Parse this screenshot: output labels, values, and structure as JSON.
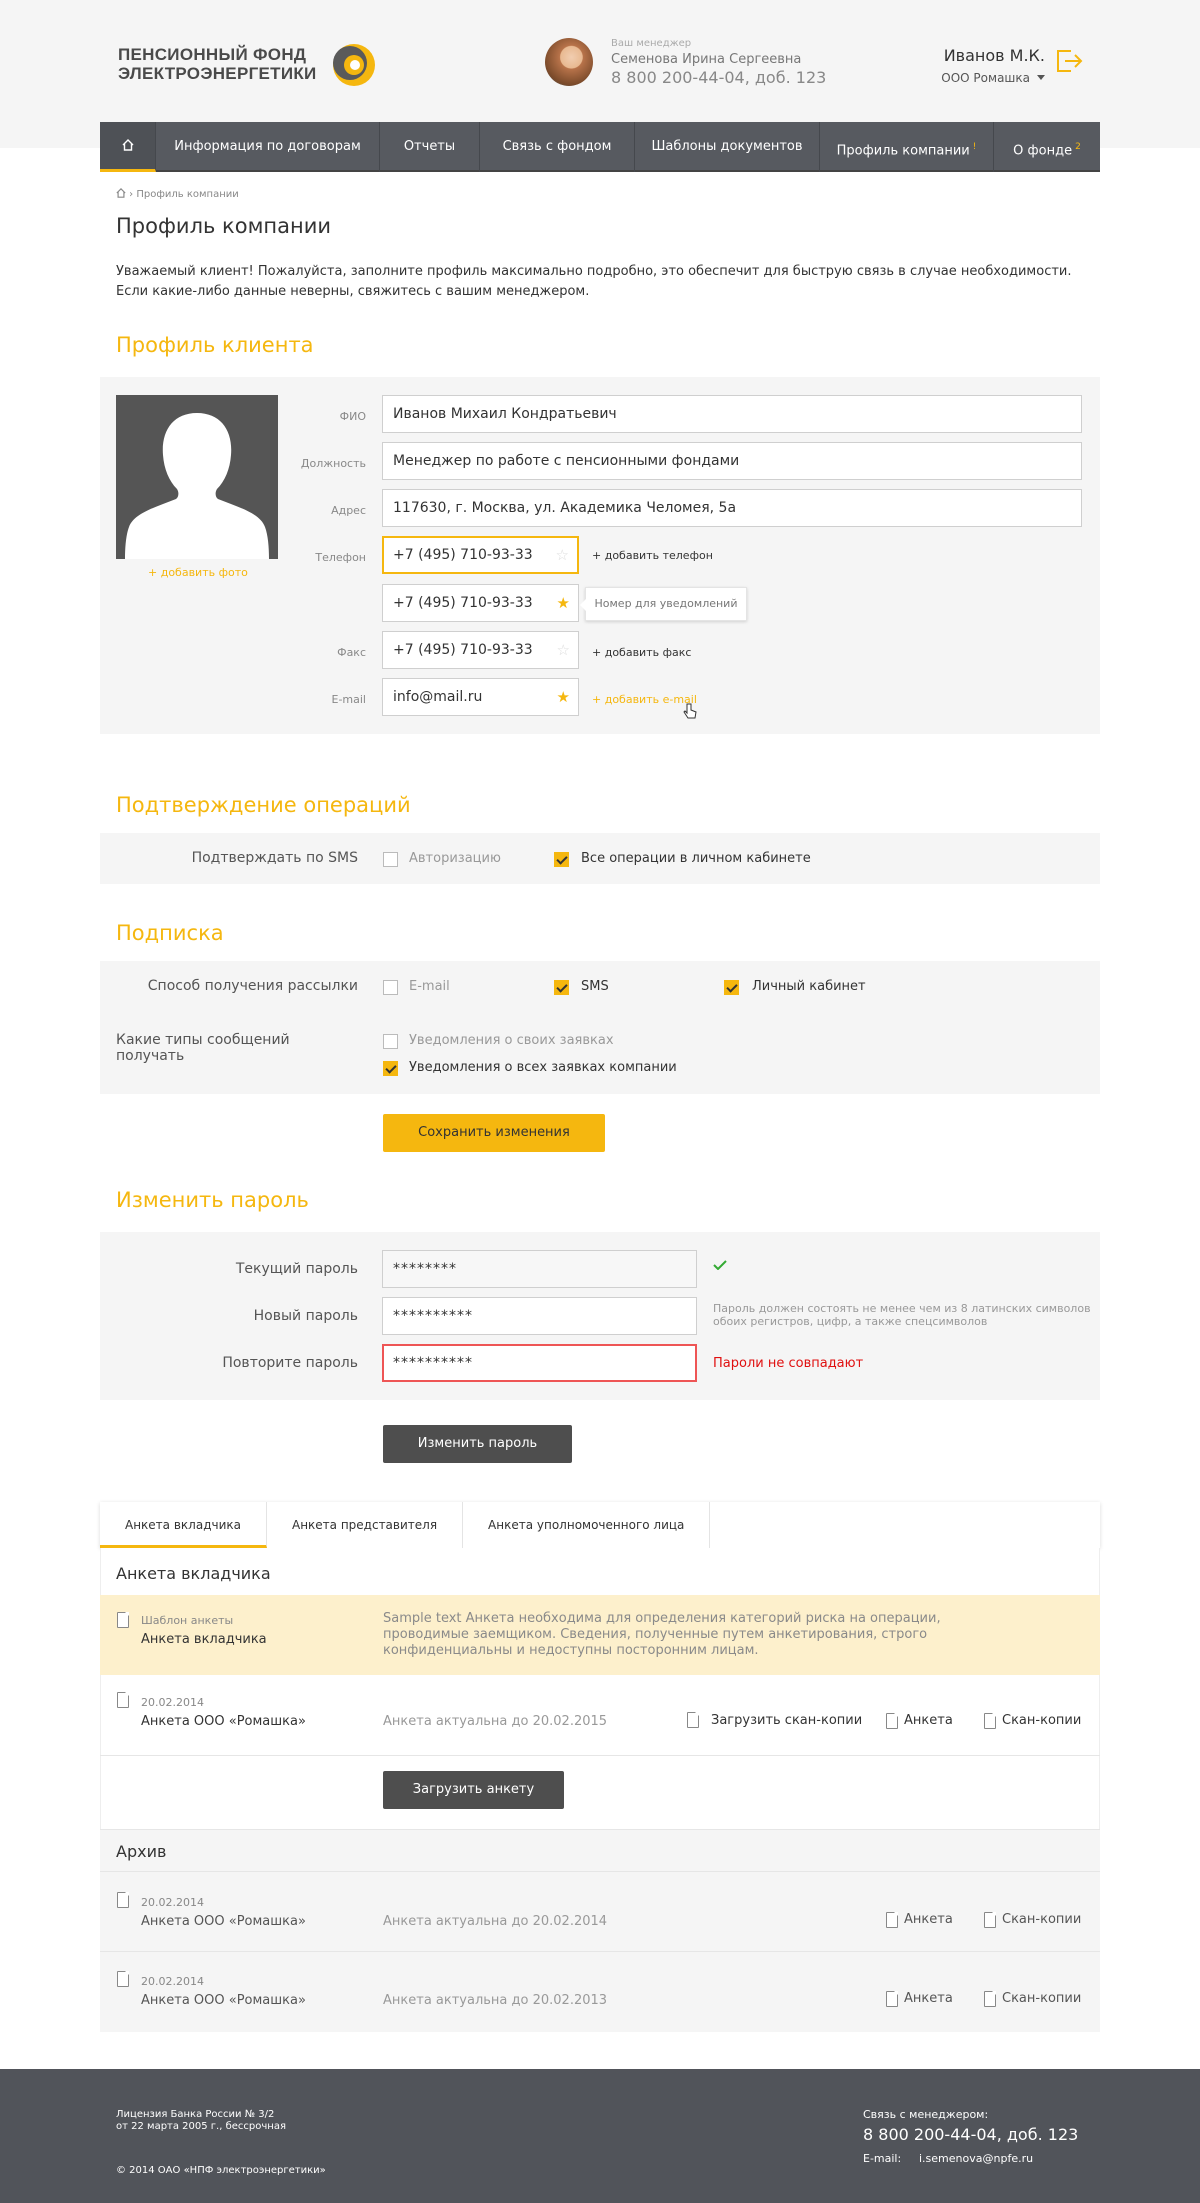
{
  "header": {
    "logo_line1": "ПЕНСИОННЫЙ ФОНД",
    "logo_line2": "ЭЛЕКТРОЭНЕРГЕТИКИ",
    "manager_caption": "Ваш менеджер",
    "manager_name": "Семенова Ирина Сергеевна",
    "manager_phone": "8 800 200-44-04, доб. 123",
    "user_name": "Иванов М.К.",
    "user_org": "ООО Ромашка"
  },
  "nav": {
    "items": [
      {
        "label": "Информация по договорам"
      },
      {
        "label": "Отчеты"
      },
      {
        "label": "Связь с фондом"
      },
      {
        "label": "Шаблоны документов"
      },
      {
        "label": "Профиль компании",
        "badge": "!"
      },
      {
        "label": "О фонде",
        "badge": "2"
      }
    ]
  },
  "breadcrumb": {
    "current": "Профиль компании"
  },
  "page": {
    "title": "Профиль компании",
    "intro_1": "Уважаемый клиент! Пожалуйста, заполните профиль максимально подробно, это обеспечит для быструю связь в случае необходимости.",
    "intro_2": "Если какие-либо данные неверны, свяжитесь с вашим менеджером."
  },
  "profile": {
    "title": "Профиль клиента",
    "add_photo": "+ добавить фото",
    "labels": {
      "fio": "ФИО",
      "position": "Должность",
      "address": "Адрес",
      "phone": "Телефон",
      "fax": "Факс",
      "email": "E-mail"
    },
    "values": {
      "fio": "Иванов Михаил Кондратьевич",
      "position": "Менеджер по работе с пенсионными фондами",
      "address": "117630, г. Москва, ул. Академика Челомея, 5а",
      "phone1": "+7 (495) 710-93-33",
      "phone2": "+7 (495) 710-93-33",
      "fax": "+7 (495) 710-93-33",
      "email": "info@mail.ru"
    },
    "add_phone": "+ добавить телефон",
    "add_fax": "+ добавить факс",
    "add_email": "+ добавить  e-mail",
    "tooltip": "Номер для уведомлений"
  },
  "confirm": {
    "title": "Подтверждение операций",
    "label": "Подтверждать по SMS",
    "opt1": "Авторизацию",
    "opt2": "Все операции в личном кабинете"
  },
  "subscription": {
    "title": "Подписка",
    "label1": "Способ получения рассылки",
    "o_email": "E-mail",
    "o_sms": "SMS",
    "o_cabinet": "Личный кабинет",
    "label2": "Какие типы сообщений получать",
    "t1": "Уведомления о своих заявках",
    "t2": "Уведомления о всех заявках компании",
    "save": "Сохранить изменения"
  },
  "password": {
    "title": "Изменить пароль",
    "current_label": "Текущий пароль",
    "current": "********",
    "new_label": "Новый пароль",
    "new": "**********",
    "repeat_label": "Повторите пароль",
    "repeat": "**********",
    "hint": "Пароль должен состоять не менее чем из 8 латинских символов обоих регистров, цифр, а также спецсимволов",
    "error": "Пароли не совпадают",
    "submit": "Изменить пароль"
  },
  "tabs": [
    "Анкета вкладчика",
    "Анкета представителя",
    "Анкета уполномоченного лица"
  ],
  "form": {
    "section_title": "Анкета вкладчика",
    "tpl_caption": "Шаблон анкеты",
    "tpl_name": "Анкета вкладчика",
    "tpl_text": "Sample text Анкета необходима для определения категорий риска на операции, проводимые заемщиком. Сведения, полученные путем анкетирования, строго конфиденциальны и недоступны посторонним лицам.",
    "current": {
      "date": "20.02.2014",
      "name": "Анкета ООО «Ромашка»",
      "status": "Анкета актуальна до 20.02.2015",
      "upload_scans": "Загрузить скан-копии",
      "form_link": "Анкета",
      "scans_link": "Скан-копии"
    },
    "upload_btn": "Загрузить анкету",
    "archive_title": "Архив",
    "archive": [
      {
        "date": "20.02.2014",
        "name": "Анкета ООО «Ромашка»",
        "status": "Анкета актуальна до 20.02.2014",
        "form_link": "Анкета",
        "scans_link": "Скан-копии"
      },
      {
        "date": "20.02.2014",
        "name": "Анкета ООО «Ромашка»",
        "status": "Анкета актуальна до 20.02.2013",
        "form_link": "Анкета",
        "scans_link": "Скан-копии"
      }
    ]
  },
  "footer": {
    "license1": "Лицензия Банка России № 3/2",
    "license2": "от 22 марта 2005 г., бессрочная",
    "copyright": "© 2014 ОАО «НПФ электроэнергетики»",
    "contact_caption": "Связь с менеджером:",
    "phone": "8 800 200-44-04, доб. 123",
    "email_label": "E-mail:",
    "email": "i.semenova@npfe.ru"
  },
  "colors": {
    "accent": "#f5b70f",
    "nav_bg": "#575a60",
    "footer_bg": "#51545a",
    "error": "#e01010"
  }
}
